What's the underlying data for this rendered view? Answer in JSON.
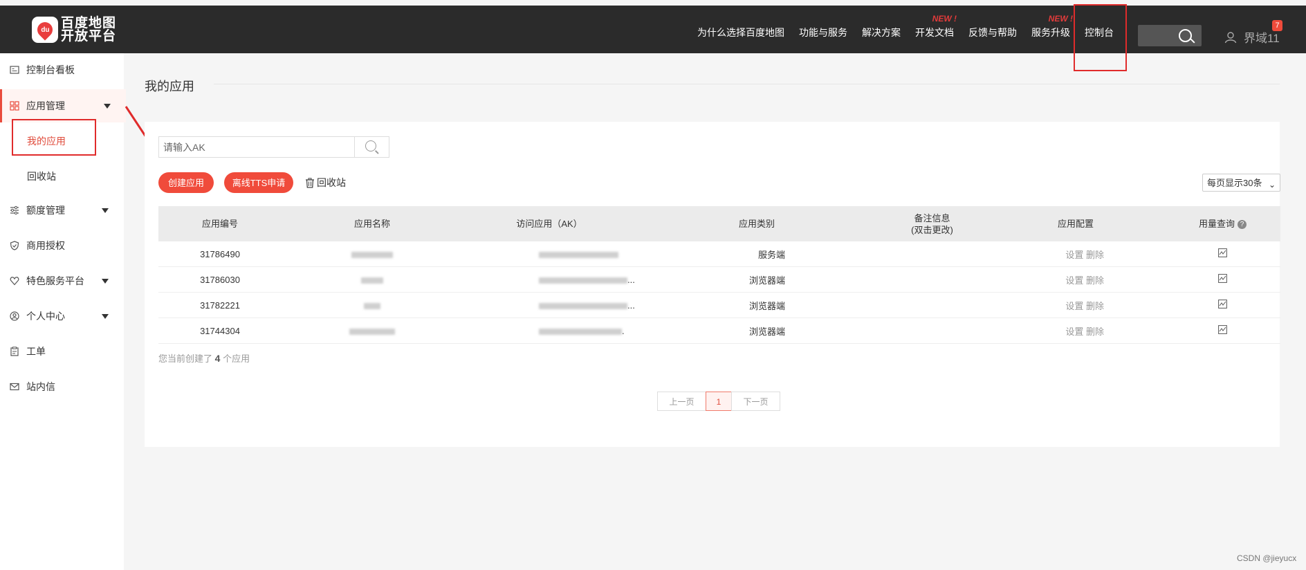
{
  "header": {
    "logo_mark": "du",
    "logo_line1": "百度地图",
    "logo_line2": "开放平台",
    "nav": [
      {
        "label": "为什么选择百度地图"
      },
      {
        "label": "功能与服务"
      },
      {
        "label": "解决方案"
      },
      {
        "label": "开发文档",
        "tag": "NEW !"
      },
      {
        "label": "反馈与帮助"
      },
      {
        "label": "服务升级",
        "tag": "NEW !"
      },
      {
        "label": "控制台"
      }
    ],
    "user_name": "界域11",
    "notification_count": "7"
  },
  "sidebar": {
    "items": [
      {
        "label": "控制台看板",
        "icon": "dashboard-icon"
      },
      {
        "label": "应用管理",
        "icon": "grid-icon"
      },
      {
        "label": "额度管理",
        "icon": "sliders-icon"
      },
      {
        "label": "商用授权",
        "icon": "shield-icon"
      },
      {
        "label": "特色服务平台",
        "icon": "heart-icon"
      },
      {
        "label": "个人中心",
        "icon": "user-circle-icon"
      },
      {
        "label": "工单",
        "icon": "clipboard-icon"
      },
      {
        "label": "站内信",
        "icon": "mail-icon"
      }
    ],
    "sub_items": [
      {
        "label": "我的应用"
      },
      {
        "label": "回收站"
      }
    ]
  },
  "main": {
    "title": "我的应用",
    "search_placeholder": "请输入AK",
    "create_button": "创建应用",
    "tts_button": "离线TTS申请",
    "recycle_link": "回收站",
    "per_page": "每页显示30条",
    "columns": [
      "应用编号",
      "应用名称",
      "访问应用（AK）",
      "应用类别",
      "备注信息",
      "(双击更改)",
      "应用配置",
      "用量查询"
    ],
    "rows": [
      {
        "id": "31786490",
        "ak_suffix": "",
        "type": "服务端",
        "config_set": "设置",
        "config_delete": "删除"
      },
      {
        "id": "31786030",
        "ak_suffix": "...",
        "type": "浏览器端",
        "config_set": "设置",
        "config_delete": "删除"
      },
      {
        "id": "31782221",
        "ak_suffix": "...",
        "type": "浏览器端",
        "config_set": "设置",
        "config_delete": "删除"
      },
      {
        "id": "31744304",
        "ak_suffix": ".",
        "type": "浏览器端",
        "config_set": "设置",
        "config_delete": "删除"
      }
    ],
    "summary_prefix": "您当前创建了",
    "summary_count": "4",
    "summary_suffix": "个应用",
    "pager": {
      "prev": "上一页",
      "current": "1",
      "next": "下一页"
    }
  },
  "watermark": "CSDN @jieyucx",
  "colors": {
    "accent": "#f04b3b",
    "topbar": "#2b2b2b",
    "annotation": "#e02b2b"
  }
}
